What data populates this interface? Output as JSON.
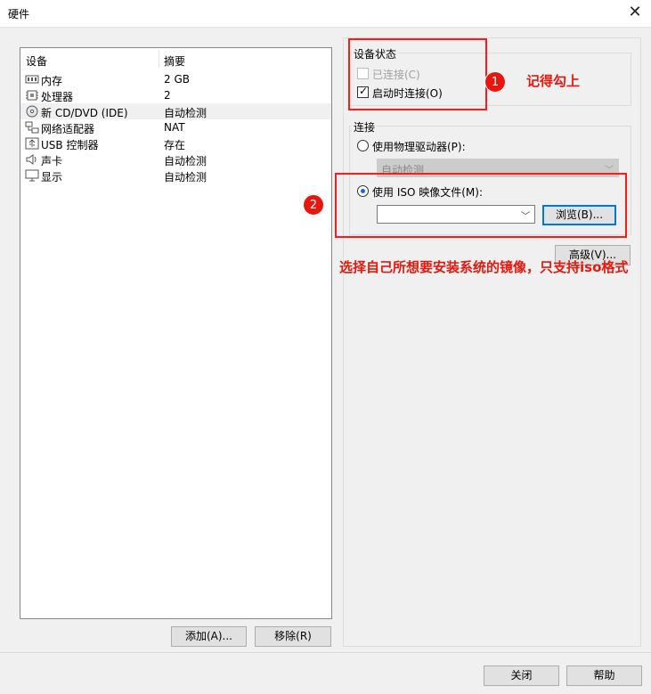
{
  "window": {
    "title": "硬件",
    "close_symbol": "✕"
  },
  "device_list": {
    "headers": {
      "device": "设备",
      "summary": "摘要"
    },
    "rows": [
      {
        "icon": "memory-icon",
        "name": "内存",
        "summary": "2 GB"
      },
      {
        "icon": "processor-icon",
        "name": "处理器",
        "summary": "2"
      },
      {
        "icon": "cd-dvd-icon",
        "name": "新 CD/DVD (IDE)",
        "summary": "自动检测",
        "selected": true
      },
      {
        "icon": "network-adapter-icon",
        "name": "网络适配器",
        "summary": "NAT"
      },
      {
        "icon": "usb-controller-icon",
        "name": "USB 控制器",
        "summary": "存在"
      },
      {
        "icon": "sound-card-icon",
        "name": "声卡",
        "summary": "自动检测"
      },
      {
        "icon": "display-icon",
        "name": "显示",
        "summary": "自动检测"
      }
    ],
    "add_label": "添加(A)...",
    "remove_label": "移除(R)"
  },
  "device_status": {
    "title": "设备状态",
    "connected_label": "已连接(C)",
    "connected_checked": false,
    "connect_at_power_on_label": "启动时连接(O)",
    "connect_at_power_on_checked": true
  },
  "connection": {
    "title": "连接",
    "physical_drive_label": "使用物理驱动器(P):",
    "physical_drive_value": "自动检测",
    "iso_label": "使用 ISO 映像文件(M):",
    "iso_value": "",
    "browse_label": "浏览(B)...",
    "advanced_label": "高级(V)...",
    "selected_option": "iso"
  },
  "annotations": {
    "badge1": "1",
    "note1": "记得勾上",
    "badge2": "2",
    "note2": "选择自己所想要安装系统的镜像，只支持iso格式",
    "color": "#e8170d"
  },
  "footer": {
    "close_label": "关闭",
    "help_label": "帮助"
  }
}
